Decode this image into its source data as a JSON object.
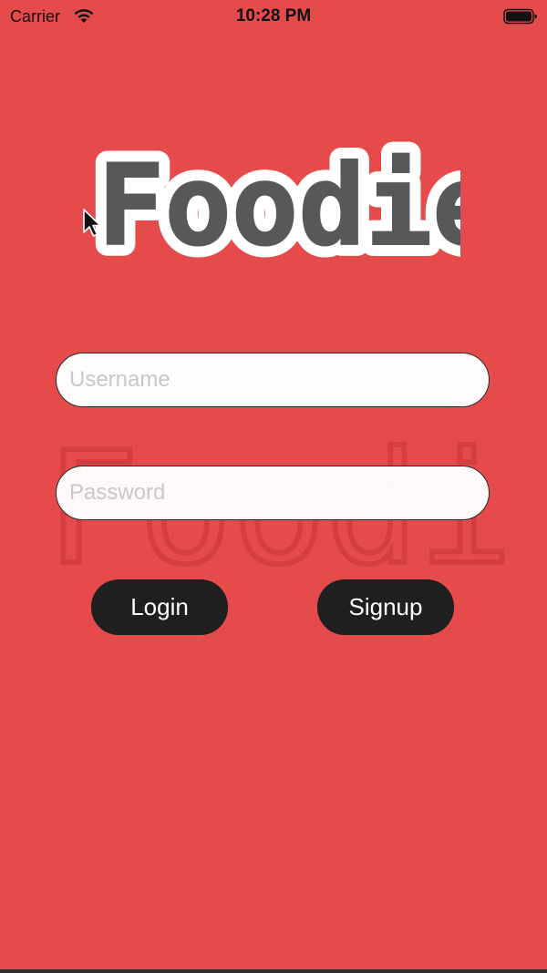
{
  "status_bar": {
    "carrier": "Carrier",
    "time": "10:28 PM",
    "icons": [
      "wifi-icon",
      "battery-icon"
    ]
  },
  "logo": {
    "text": "Foodie"
  },
  "watermark": {
    "text": "Foodie"
  },
  "form": {
    "username_placeholder": "Username",
    "username_value": "",
    "password_placeholder": "Password",
    "password_value": ""
  },
  "buttons": {
    "login_label": "Login",
    "signup_label": "Signup"
  },
  "colors": {
    "background": "#e64b4c",
    "button_bg": "#1f1f1f",
    "logo_text": "#58585a",
    "field_bg": "#ffffff"
  }
}
